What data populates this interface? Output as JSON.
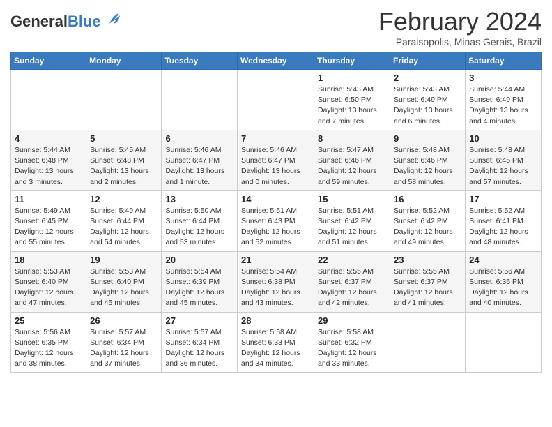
{
  "header": {
    "logo_general": "General",
    "logo_blue": "Blue",
    "month_title": "February 2024",
    "subtitle": "Paraisopolis, Minas Gerais, Brazil"
  },
  "days_of_week": [
    "Sunday",
    "Monday",
    "Tuesday",
    "Wednesday",
    "Thursday",
    "Friday",
    "Saturday"
  ],
  "weeks": [
    [
      {
        "day": "",
        "info": ""
      },
      {
        "day": "",
        "info": ""
      },
      {
        "day": "",
        "info": ""
      },
      {
        "day": "",
        "info": ""
      },
      {
        "day": "1",
        "info": "Sunrise: 5:43 AM\nSunset: 6:50 PM\nDaylight: 13 hours and 7 minutes."
      },
      {
        "day": "2",
        "info": "Sunrise: 5:43 AM\nSunset: 6:49 PM\nDaylight: 13 hours and 6 minutes."
      },
      {
        "day": "3",
        "info": "Sunrise: 5:44 AM\nSunset: 6:49 PM\nDaylight: 13 hours and 4 minutes."
      }
    ],
    [
      {
        "day": "4",
        "info": "Sunrise: 5:44 AM\nSunset: 6:48 PM\nDaylight: 13 hours and 3 minutes."
      },
      {
        "day": "5",
        "info": "Sunrise: 5:45 AM\nSunset: 6:48 PM\nDaylight: 13 hours and 2 minutes."
      },
      {
        "day": "6",
        "info": "Sunrise: 5:46 AM\nSunset: 6:47 PM\nDaylight: 13 hours and 1 minute."
      },
      {
        "day": "7",
        "info": "Sunrise: 5:46 AM\nSunset: 6:47 PM\nDaylight: 13 hours and 0 minutes."
      },
      {
        "day": "8",
        "info": "Sunrise: 5:47 AM\nSunset: 6:46 PM\nDaylight: 12 hours and 59 minutes."
      },
      {
        "day": "9",
        "info": "Sunrise: 5:48 AM\nSunset: 6:46 PM\nDaylight: 12 hours and 58 minutes."
      },
      {
        "day": "10",
        "info": "Sunrise: 5:48 AM\nSunset: 6:45 PM\nDaylight: 12 hours and 57 minutes."
      }
    ],
    [
      {
        "day": "11",
        "info": "Sunrise: 5:49 AM\nSunset: 6:45 PM\nDaylight: 12 hours and 55 minutes."
      },
      {
        "day": "12",
        "info": "Sunrise: 5:49 AM\nSunset: 6:44 PM\nDaylight: 12 hours and 54 minutes."
      },
      {
        "day": "13",
        "info": "Sunrise: 5:50 AM\nSunset: 6:44 PM\nDaylight: 12 hours and 53 minutes."
      },
      {
        "day": "14",
        "info": "Sunrise: 5:51 AM\nSunset: 6:43 PM\nDaylight: 12 hours and 52 minutes."
      },
      {
        "day": "15",
        "info": "Sunrise: 5:51 AM\nSunset: 6:42 PM\nDaylight: 12 hours and 51 minutes."
      },
      {
        "day": "16",
        "info": "Sunrise: 5:52 AM\nSunset: 6:42 PM\nDaylight: 12 hours and 49 minutes."
      },
      {
        "day": "17",
        "info": "Sunrise: 5:52 AM\nSunset: 6:41 PM\nDaylight: 12 hours and 48 minutes."
      }
    ],
    [
      {
        "day": "18",
        "info": "Sunrise: 5:53 AM\nSunset: 6:40 PM\nDaylight: 12 hours and 47 minutes."
      },
      {
        "day": "19",
        "info": "Sunrise: 5:53 AM\nSunset: 6:40 PM\nDaylight: 12 hours and 46 minutes."
      },
      {
        "day": "20",
        "info": "Sunrise: 5:54 AM\nSunset: 6:39 PM\nDaylight: 12 hours and 45 minutes."
      },
      {
        "day": "21",
        "info": "Sunrise: 5:54 AM\nSunset: 6:38 PM\nDaylight: 12 hours and 43 minutes."
      },
      {
        "day": "22",
        "info": "Sunrise: 5:55 AM\nSunset: 6:37 PM\nDaylight: 12 hours and 42 minutes."
      },
      {
        "day": "23",
        "info": "Sunrise: 5:55 AM\nSunset: 6:37 PM\nDaylight: 12 hours and 41 minutes."
      },
      {
        "day": "24",
        "info": "Sunrise: 5:56 AM\nSunset: 6:36 PM\nDaylight: 12 hours and 40 minutes."
      }
    ],
    [
      {
        "day": "25",
        "info": "Sunrise: 5:56 AM\nSunset: 6:35 PM\nDaylight: 12 hours and 38 minutes."
      },
      {
        "day": "26",
        "info": "Sunrise: 5:57 AM\nSunset: 6:34 PM\nDaylight: 12 hours and 37 minutes."
      },
      {
        "day": "27",
        "info": "Sunrise: 5:57 AM\nSunset: 6:34 PM\nDaylight: 12 hours and 36 minutes."
      },
      {
        "day": "28",
        "info": "Sunrise: 5:58 AM\nSunset: 6:33 PM\nDaylight: 12 hours and 34 minutes."
      },
      {
        "day": "29",
        "info": "Sunrise: 5:58 AM\nSunset: 6:32 PM\nDaylight: 12 hours and 33 minutes."
      },
      {
        "day": "",
        "info": ""
      },
      {
        "day": "",
        "info": ""
      }
    ]
  ]
}
